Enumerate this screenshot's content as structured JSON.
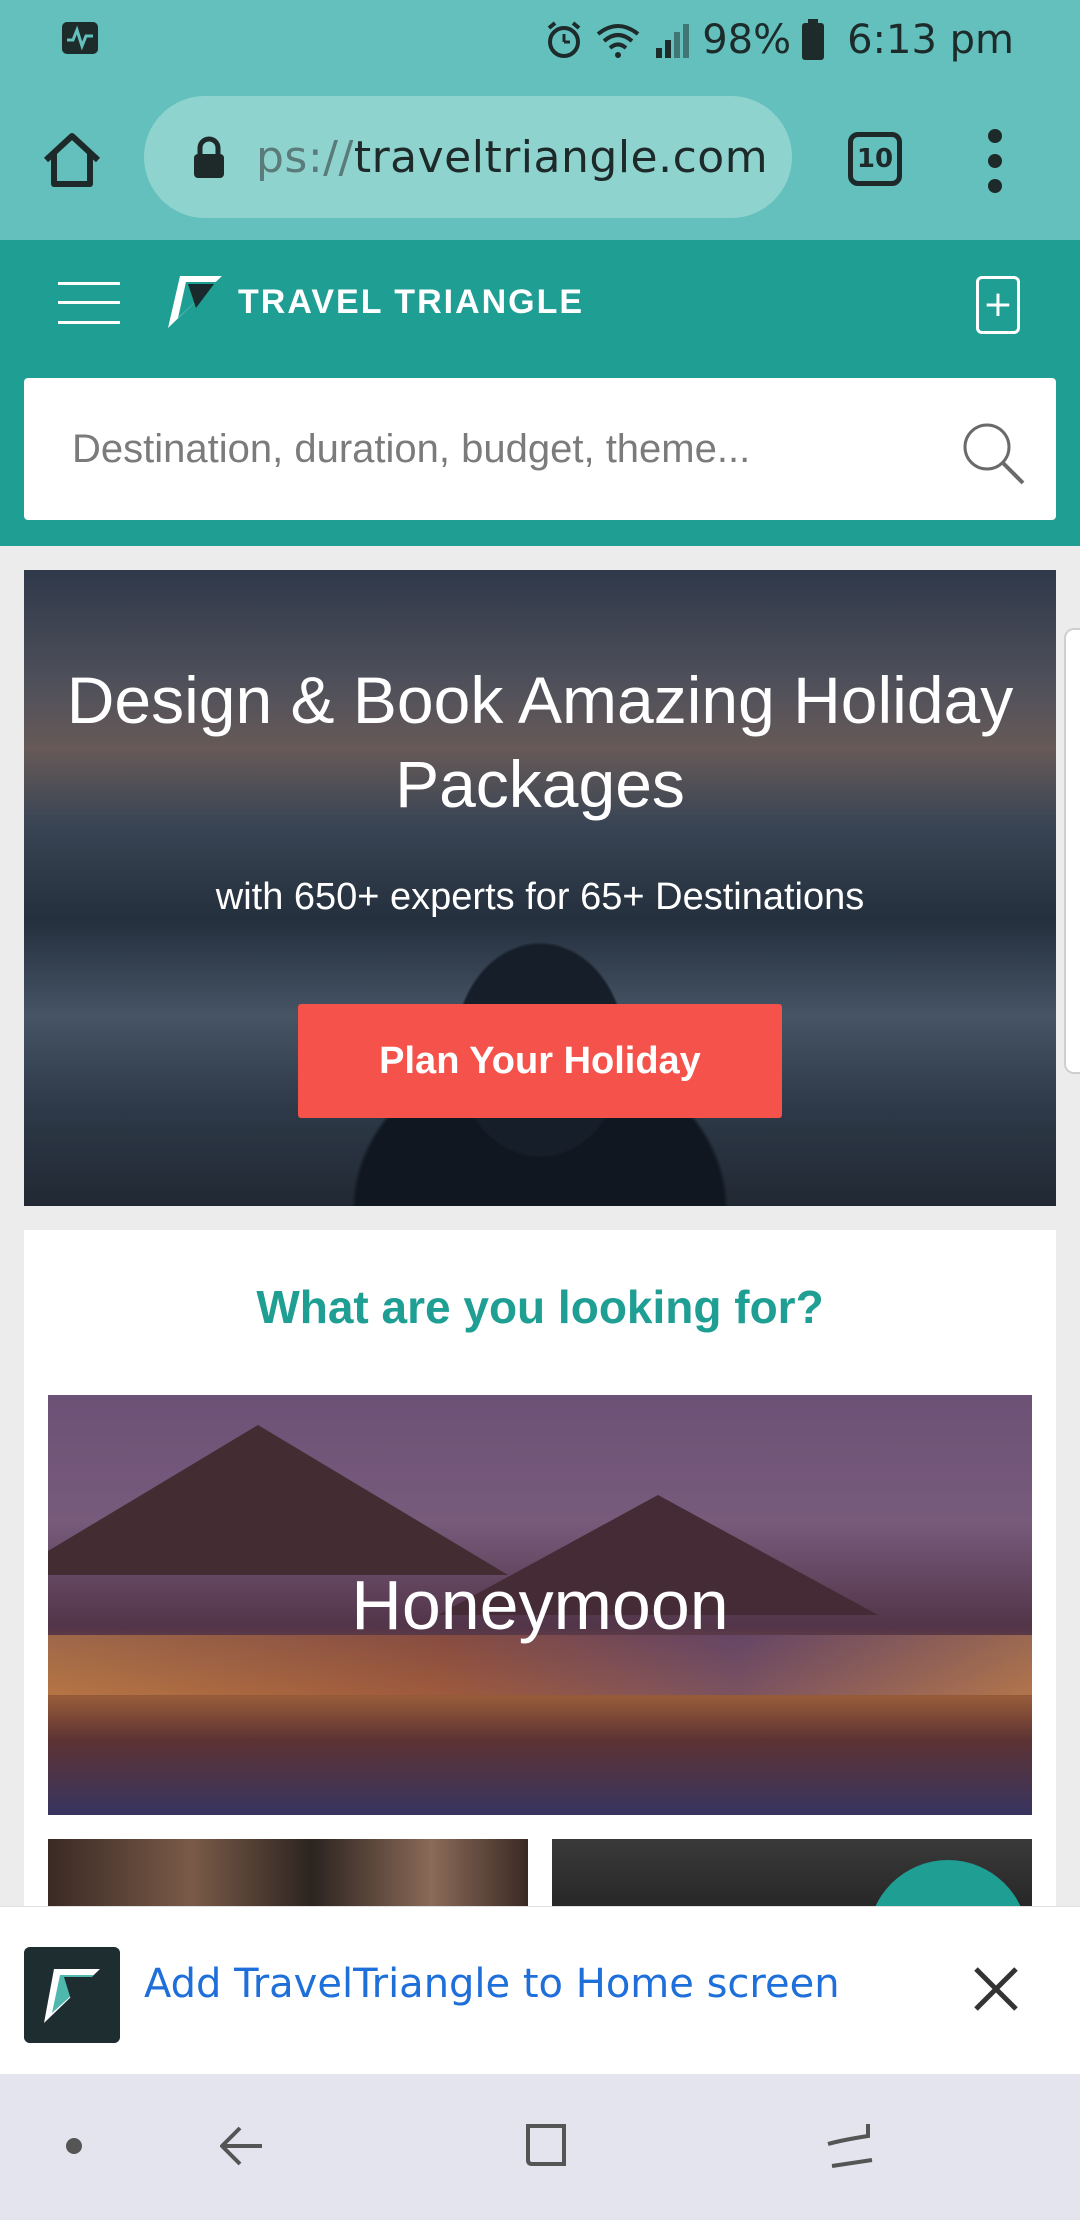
{
  "status_bar": {
    "battery": "98%",
    "time": "6:13 pm"
  },
  "browser": {
    "url_prefix": "ps://",
    "url_domain": "traveltriangle.com",
    "tab_count": "10"
  },
  "site": {
    "logo_text": "TRAVEL TRIANGLE",
    "search_placeholder": "Destination, duration, budget, theme..."
  },
  "hero": {
    "title": "Design & Book Amazing Holiday Packages",
    "subtitle": "with 650+ experts for 65+ Destinations",
    "cta_label": "Plan Your Holiday"
  },
  "looking_for": {
    "title": "What are you looking for?",
    "cards": [
      {
        "label": "Honeymoon"
      }
    ]
  },
  "a2hs_banner": {
    "text": "Add TravelTriangle to Home screen"
  },
  "colors": {
    "teal": "#1f9e94",
    "status_teal": "#64c0bd",
    "cta_red": "#f4524a",
    "link_blue": "#1e6fd9"
  }
}
